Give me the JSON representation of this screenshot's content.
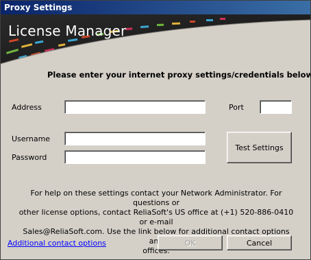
{
  "window": {
    "title": "Proxy Settings"
  },
  "banner": {
    "title": "License Manager"
  },
  "instruction": "Please enter your internet proxy settings/credentials below:",
  "fields": {
    "address": {
      "label": "Address",
      "value": ""
    },
    "port": {
      "label": "Port",
      "value": ""
    },
    "username": {
      "label": "Username",
      "value": ""
    },
    "password": {
      "label": "Password",
      "value": ""
    }
  },
  "buttons": {
    "test_settings": "Test Settings",
    "ok": "OK",
    "cancel": "Cancel"
  },
  "help": {
    "line1": "For help on these settings contact your Network Administrator.  For questions or",
    "line2": "other license options, contact ReliaSoft's US office at (+1) 520-886-0410 or e-mail",
    "line3": "Sales@ReliaSoft.com. Use the link below for additional contact options and",
    "line4": "offices."
  },
  "link": {
    "label": "Additional contact options"
  },
  "colors": {
    "titlebar": "#0a246a",
    "dialog_bg": "#d4d0c8",
    "banner_bg": "#202020",
    "link": "#0000ff"
  }
}
